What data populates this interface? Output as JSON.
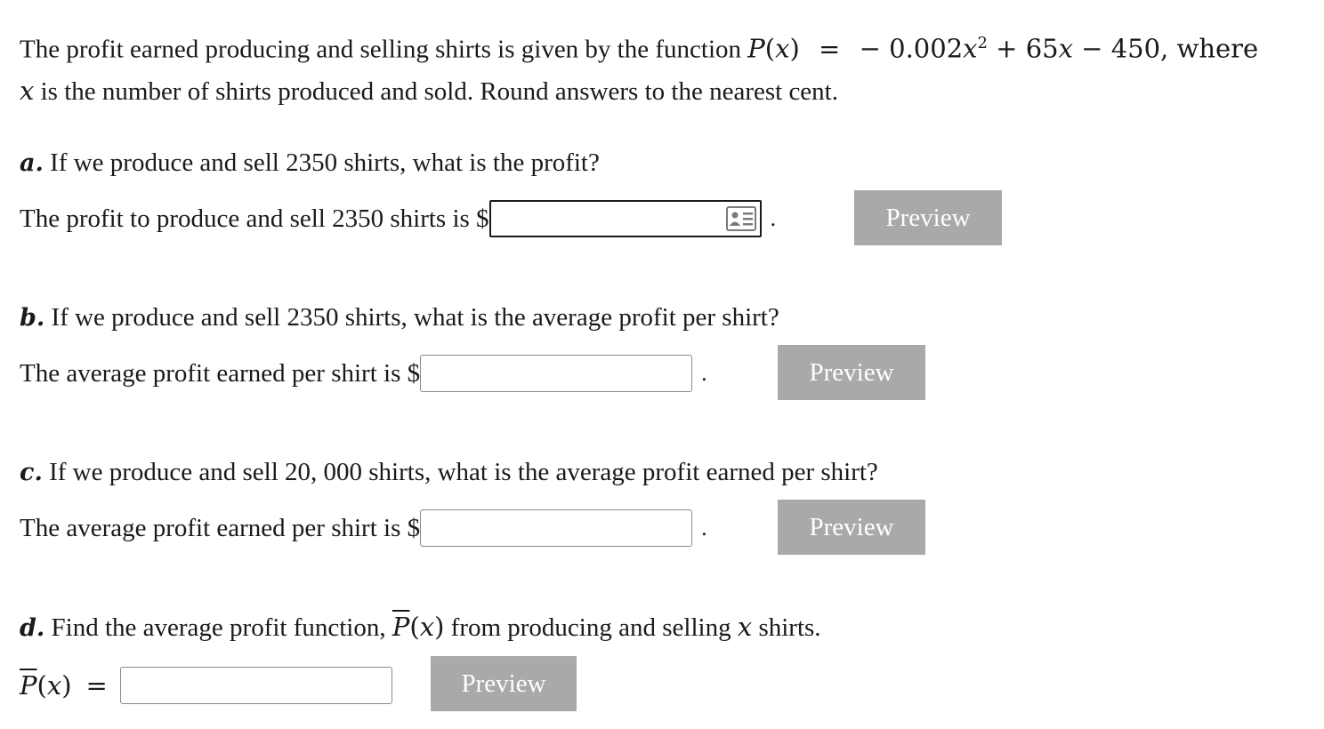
{
  "intro": {
    "text_start": "The profit earned producing and selling shirts is given by the function ",
    "func_name": "P",
    "func_var": "x",
    "equals": "=",
    "expr_1": "− 0.002",
    "expr_var_1": "x",
    "expr_exp": "2",
    "expr_2": " + 65",
    "expr_var_2": "x",
    "expr_3": " − 450, where",
    "line2_var": "x",
    "line2_text": " is the number of shirts produced and sold. Round answers to the nearest cent."
  },
  "parts": [
    {
      "letter": "a.",
      "question": "If we produce and sell 2350 shirts, what is the profit?",
      "answer_prefix": "The profit to produce and sell 2350 shirts is $",
      "answer_value": "",
      "period": ".",
      "preview_label": "Preview"
    },
    {
      "letter": "b.",
      "question": "If we produce and sell 2350 shirts, what is the average profit per shirt?",
      "answer_prefix": "The average profit earned per shirt is $",
      "answer_value": "",
      "period": ".",
      "preview_label": "Preview"
    },
    {
      "letter": "c.",
      "question": "If we produce and sell 20, 000 shirts, what is the average profit earned per shirt?",
      "answer_prefix": "The average profit earned per shirt is $",
      "answer_value": "",
      "period": ".",
      "preview_label": "Preview"
    },
    {
      "letter": "d.",
      "question_start": "Find the average profit function, ",
      "func_name": "P",
      "func_var": "x",
      "question_mid": " from producing and selling ",
      "question_var": "x",
      "question_end": " shirts.",
      "answer_func_name": "P",
      "answer_func_var": "x",
      "answer_equals": "=",
      "answer_value": "",
      "preview_label": "Preview"
    }
  ],
  "icons": {
    "answer_helper": "id-card-icon"
  },
  "colors": {
    "button_bg": "#a9a9a9",
    "button_text": "#ffffff",
    "text": "#1a1a1a",
    "field_border": "#8a8a8a"
  }
}
